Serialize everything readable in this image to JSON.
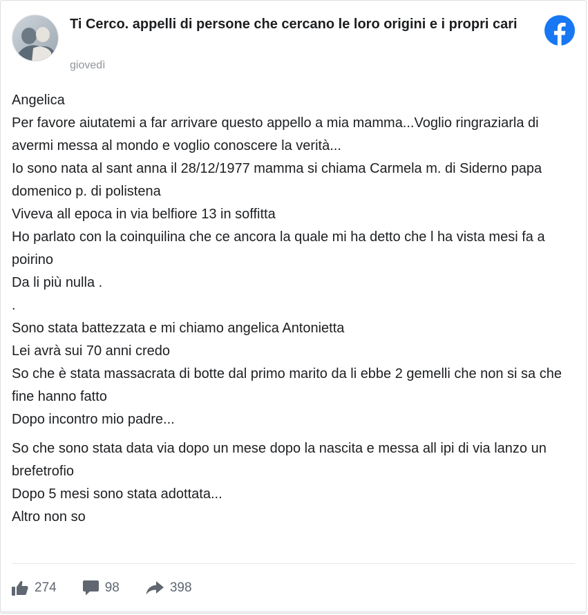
{
  "post": {
    "page_name": "Ti Cerco. appelli di persone che cercano le loro origini e i propri cari",
    "date": "giovedì",
    "body": {
      "block1": [
        "Angelica",
        "Per favore aiutatemi a far arrivare questo appello a mia mamma...Voglio ringraziarla di avermi messa al mondo e voglio conoscere la verità...",
        "Io sono nata al sant anna il 28/12/1977 mamma si chiama Carmela m. di Siderno papa domenico p. di polistena",
        "Viveva all epoca in via belfiore 13 in soffitta",
        "Ho parlato con la coinquilina che ce ancora la quale mi ha detto che l ha vista mesi fa a poirino",
        "Da li più nulla .",
        ".",
        "Sono stata battezzata e mi chiamo angelica Antonietta",
        "Lei avrà sui 70 anni credo",
        "So che è stata massacrata di botte dal primo marito da li ebbe 2 gemelli che non si sa che fine hanno fatto",
        "Dopo incontro mio padre..."
      ],
      "block2": [
        "So che sono stata data via dopo un mese dopo la nascita e messa all ipi di via lanzo un brefetrofio",
        "Dopo 5 mesi sono stata adottata...",
        "Altro non so"
      ]
    }
  },
  "stats": {
    "likes": "274",
    "comments": "98",
    "shares": "398"
  },
  "icons": {
    "brand": "facebook-logo-icon",
    "like": "thumbs-up-icon",
    "comment": "comment-bubble-icon",
    "share": "share-arrow-icon"
  },
  "colors": {
    "facebook_blue": "#1877f2",
    "icon_gray": "#606770",
    "date_gray": "#90949c",
    "text": "#1c1e21"
  }
}
